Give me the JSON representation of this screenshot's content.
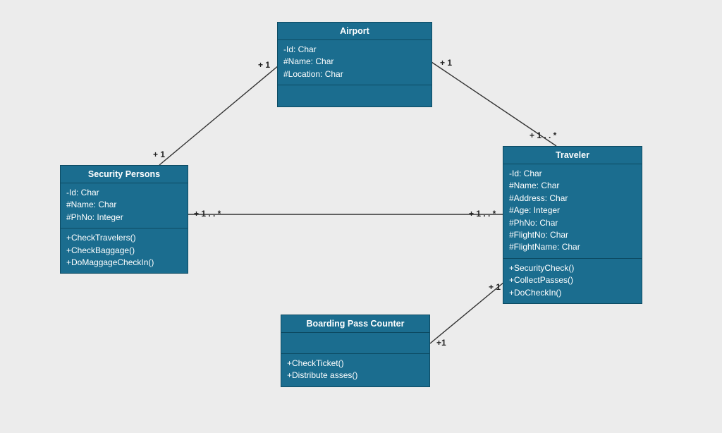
{
  "classes": {
    "airport": {
      "title": "Airport",
      "attrs": [
        "-Id: Char",
        "#Name: Char",
        "#Location: Char"
      ],
      "ops": []
    },
    "security": {
      "title": "Security Persons",
      "attrs": [
        "-Id: Char",
        "#Name: Char",
        "#PhNo: Integer"
      ],
      "ops": [
        "+CheckTravelers()",
        "+CheckBaggage()",
        "+DoMaggageCheckIn()"
      ]
    },
    "traveler": {
      "title": "Traveler",
      "attrs": [
        "-Id: Char",
        "#Name: Char",
        "#Address: Char",
        "#Age: Integer",
        "#PhNo: Char",
        "#FlightNo: Char",
        "#FlightName: Char"
      ],
      "ops": [
        "+SecurityCheck()",
        "+CollectPasses()",
        "+DoCheckIn()"
      ]
    },
    "boarding": {
      "title": "Boarding Pass Counter",
      "attrs": [],
      "ops": [
        "+CheckTicket()",
        "+Distribute asses()"
      ]
    }
  },
  "multiplicities": {
    "airport_sec_near_airport": "+ 1",
    "airport_sec_near_sec": "+ 1",
    "airport_trav_near_airport": "+ 1",
    "airport_trav_near_trav": "+ 1 . . *",
    "sec_trav_near_sec": "+ 1 . . *",
    "sec_trav_near_trav": "+ 1 . . *",
    "board_trav_near_board": "+1",
    "board_trav_near_trav": "+ 1"
  }
}
